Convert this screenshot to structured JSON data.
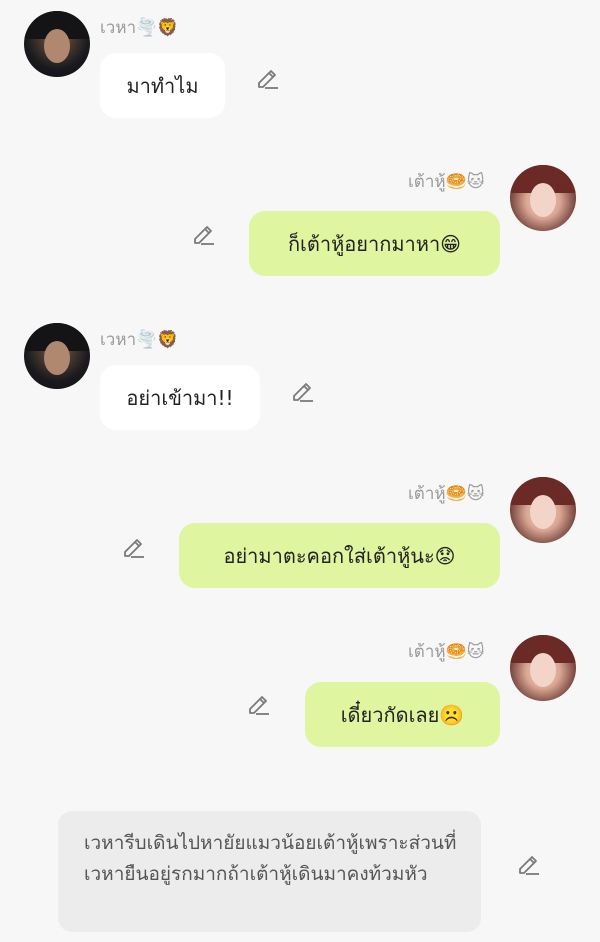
{
  "messages": [
    {
      "name": "เวหา🌪️🦁",
      "text": "มาทำไม",
      "side": "left"
    },
    {
      "name": "เต้าหู้🥯🐱",
      "text": "ก็เต้าหู้อยากมาหา😁",
      "side": "right"
    },
    {
      "name": "เวหา🌪️🦁",
      "text": "อย่าเข้ามา!!",
      "side": "left"
    },
    {
      "name": "เต้าหู้🥯🐱",
      "text": "อย่ามาตะคอกใส่เต้าหู้นะ😟",
      "side": "right"
    },
    {
      "name": "เต้าหู้🥯🐱",
      "text": "เดี๋ยวกัดเลย☹️",
      "side": "right"
    }
  ],
  "narration": {
    "text": "เวหารีบเดินไปหายัยแมวน้อยเต้าหู้เพราะส่วนที่เวหายืนอยู่รกมากถ้าเต้าหู้เดินมาคงท้วมหัว"
  },
  "colors": {
    "background": "#f7f7f7",
    "left_bubble": "#ffffff",
    "right_bubble": "#dff5a0",
    "narration_bg": "#ececec",
    "name_text": "#9a9a9a"
  },
  "icons": {
    "edit": "pencil-edit-icon"
  }
}
